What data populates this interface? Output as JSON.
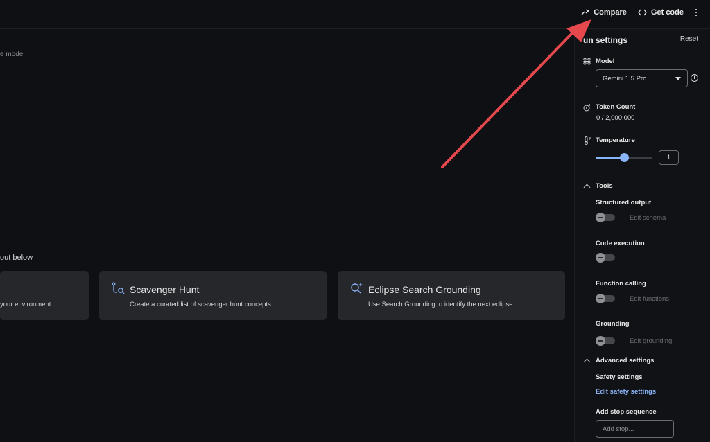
{
  "topbar": {
    "compare_label": "Compare",
    "get_code_label": "Get code"
  },
  "subbar": {
    "hint": "e model"
  },
  "main": {
    "prompt_hint": "out below",
    "cards": [
      {
        "title": "",
        "desc": "your environment."
      },
      {
        "title": "Scavenger Hunt",
        "desc": "Create a curated list of scavenger hunt concepts."
      },
      {
        "title": "Eclipse Search Grounding",
        "desc": "Use Search Grounding to identify the next eclipse."
      }
    ]
  },
  "panel": {
    "title": "un settings",
    "reset_label": "Reset",
    "model_label": "Model",
    "model_value": "Gemini 1.5 Pro",
    "token_label": "Token Count",
    "token_value": "0 / 2,000,000",
    "temperature_label": "Temperature",
    "temperature_value": "1",
    "temperature_fraction": 0.5,
    "tools_label": "Tools",
    "structured_output_label": "Structured output",
    "edit_schema_label": "Edit schema",
    "code_execution_label": "Code execution",
    "function_calling_label": "Function calling",
    "edit_functions_label": "Edit functions",
    "grounding_label": "Grounding",
    "edit_grounding_label": "Edit grounding",
    "advanced_label": "Advanced settings",
    "safety_label": "Safety settings",
    "edit_safety_label": "Edit safety settings",
    "stop_seq_label": "Add stop sequence",
    "stop_placeholder": "Add stop..."
  },
  "colors": {
    "accent_blue": "#8ab4f8",
    "annotation_arrow": "#e5484d",
    "card_bg": "#25272b"
  }
}
